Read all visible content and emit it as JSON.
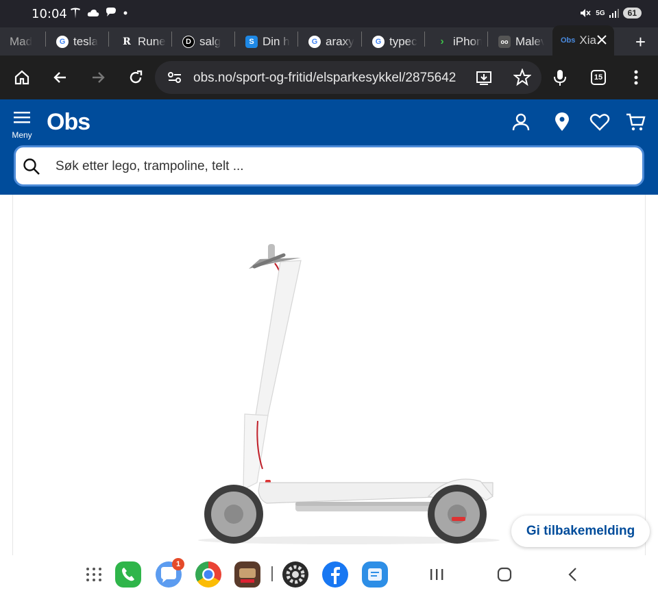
{
  "status": {
    "time": "10:04",
    "network": "5G",
    "battery": "61"
  },
  "tabs": [
    {
      "label": "Mad",
      "icon": "generic-icon"
    },
    {
      "label": "tesla",
      "icon": "google-icon"
    },
    {
      "label": "Rune",
      "icon": "r-icon"
    },
    {
      "label": "salg",
      "icon": "d-icon"
    },
    {
      "label": "Din h",
      "icon": "s-icon"
    },
    {
      "label": "araxy",
      "icon": "google-icon"
    },
    {
      "label": "typec",
      "icon": "google-icon"
    },
    {
      "label": "iPhon",
      "icon": "arrow-icon"
    },
    {
      "label": "Malev",
      "icon": "owl-icon"
    }
  ],
  "active_tab": {
    "label": "Xia",
    "favicon_text": "Obs"
  },
  "toolbar": {
    "url": "obs.no/sport-og-fritid/elsparkesykkel/2875642",
    "tab_count": "15"
  },
  "site": {
    "logo": "Obs",
    "menu_label": "Meny",
    "search_placeholder": "Søk etter lego, trampoline, telt ...",
    "brand_color": "#004c9b"
  },
  "feedback_button": "Gi tilbakemelding",
  "dock": {
    "messages_badge": "1"
  }
}
